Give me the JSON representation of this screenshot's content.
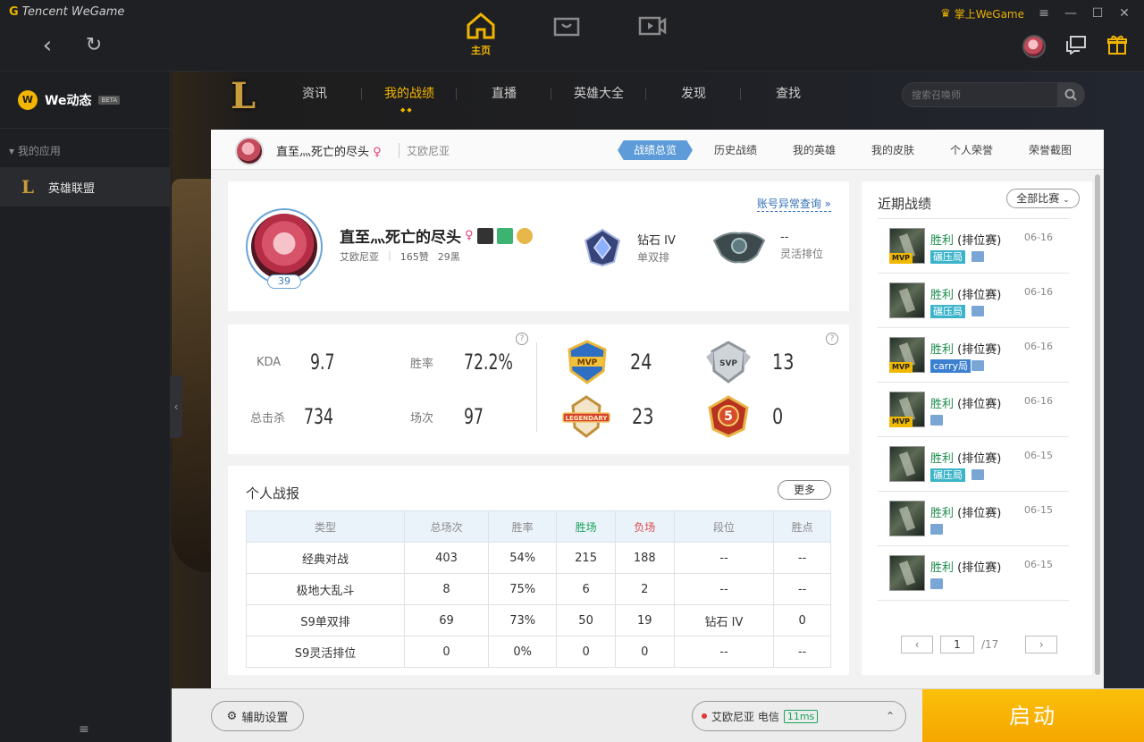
{
  "app": {
    "brand": "Tencent WeGame",
    "main_tabs": [
      {
        "label": "主页"
      },
      {
        "label": ""
      },
      {
        "label": ""
      }
    ],
    "mobile_link": "掌上WeGame"
  },
  "sidebar": {
    "title": "We动态",
    "beta": "BETA",
    "section": "▾ 我的应用",
    "apps": [
      {
        "label": "英雄联盟"
      }
    ]
  },
  "lol_nav": {
    "tabs": [
      "资讯",
      "我的战绩",
      "直播",
      "英雄大全",
      "发现",
      "查找"
    ],
    "active": "我的战绩",
    "search_placeholder": "搜索召唤师"
  },
  "subhead": {
    "name": "直至灬死亡的尽头",
    "gender": "♀",
    "region": "艾欧尼亚",
    "tabs": [
      "战绩总览",
      "历史战绩",
      "我的英雄",
      "我的皮肤",
      "个人荣誉",
      "荣誉截图"
    ],
    "active": "战绩总览"
  },
  "profile": {
    "level": "39",
    "name": "直至灬死亡的尽头",
    "gender": "♀",
    "region": "艾欧尼亚",
    "likes": "165赞",
    "blacks": "29黑",
    "abnormal_link": "账号异常查询 »",
    "solo_rank": "钻石 IV",
    "solo_label": "单双排",
    "flex_rank": "--",
    "flex_label": "灵活排位"
  },
  "stats": {
    "kda_label": "KDA",
    "kda": "9.7",
    "winrate_label": "胜率",
    "winrate": "72.2%",
    "kills_label": "总击杀",
    "kills": "734",
    "games_label": "场次",
    "games": "97",
    "help": "?",
    "medals": [
      {
        "name": "MVP",
        "count": "24"
      },
      {
        "name": "SVP",
        "count": "13"
      },
      {
        "name": "LEGENDARY",
        "count": "23"
      },
      {
        "name": "5",
        "count": "0"
      }
    ]
  },
  "report": {
    "title": "个人战报",
    "more": "更多",
    "columns": [
      "类型",
      "总场次",
      "胜率",
      "胜场",
      "负场",
      "段位",
      "胜点"
    ],
    "rows": [
      [
        "经典对战",
        "403",
        "54%",
        "215",
        "188",
        "--",
        "--"
      ],
      [
        "极地大乱斗",
        "8",
        "75%",
        "6",
        "2",
        "--",
        "--"
      ],
      [
        "S9单双排",
        "69",
        "73%",
        "50",
        "19",
        "钻石 IV",
        "0"
      ],
      [
        "S9灵活排位",
        "0",
        "0%",
        "0",
        "0",
        "--",
        "--"
      ]
    ]
  },
  "recent": {
    "title": "近期战绩",
    "filter": "全部比赛",
    "games": [
      {
        "result": "胜利",
        "mode": "(排位赛)",
        "date": "06-16",
        "mvp": "MVP",
        "tag": "碾压局"
      },
      {
        "result": "胜利",
        "mode": "(排位赛)",
        "date": "06-16",
        "mvp": "",
        "tag": "碾压局"
      },
      {
        "result": "胜利",
        "mode": "(排位赛)",
        "date": "06-16",
        "mvp": "MVP",
        "tag": "carry局"
      },
      {
        "result": "胜利",
        "mode": "(排位赛)",
        "date": "06-16",
        "mvp": "MVP",
        "tag": ""
      },
      {
        "result": "胜利",
        "mode": "(排位赛)",
        "date": "06-15",
        "mvp": "",
        "tag": "碾压局"
      },
      {
        "result": "胜利",
        "mode": "(排位赛)",
        "date": "06-15",
        "mvp": "",
        "tag": ""
      },
      {
        "result": "胜利",
        "mode": "(排位赛)",
        "date": "06-15",
        "mvp": "",
        "tag": ""
      }
    ],
    "page": "1",
    "total_pages": "/17"
  },
  "bottom": {
    "assist": "辅助设置",
    "server": "艾欧尼亚 电信",
    "ping": "11ms",
    "start": "启动"
  },
  "colors": {
    "accent": "#f0b400",
    "win": "#1c8c4c",
    "lose": "#e04a4a",
    "link": "#3470b5"
  }
}
